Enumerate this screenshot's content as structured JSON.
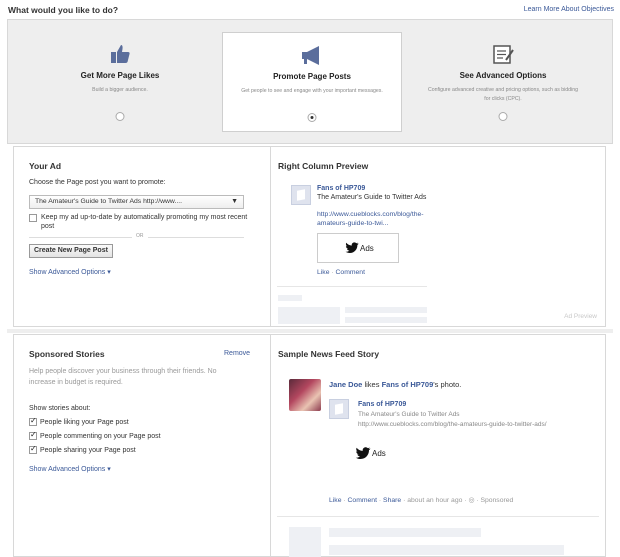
{
  "header": {
    "question": "What would you like to do?",
    "learn_more": "Learn More About Objectives"
  },
  "objectives": [
    {
      "icon": "thumbs-up-icon",
      "title": "Get More Page Likes",
      "description": "Build a bigger audience.",
      "selected": false
    },
    {
      "icon": "megaphone-icon",
      "title": "Promote Page Posts",
      "description": "Get people to see and engage with your important messages.",
      "selected": true
    },
    {
      "icon": "clipboard-icon",
      "title": "See Advanced Options",
      "description": "Configure advanced creative and pricing options, such as bidding for clicks (CPC).",
      "selected": false
    }
  ],
  "your_ad": {
    "heading": "Your Ad",
    "choose_label": "Choose the Page post you want to promote:",
    "selected_post": "The Amateur's Guide to Twitter Ads http://www....",
    "keep_updated": "Keep my ad up-to-date by automatically promoting my most recent post",
    "keep_updated_checked": false,
    "or": "OR",
    "create_button": "Create New Page Post",
    "advanced": "Show Advanced Options"
  },
  "right_column": {
    "heading": "Right Column Preview",
    "page_name": "Fans of HP709",
    "post_title": "The Amateur's Guide to Twitter Ads",
    "url": "http://www.cueblocks.com/blog/the-amateurs-guide-to-twi...",
    "image_text": "Ads",
    "like": "Like",
    "comment": "Comment",
    "ad_preview_label": "Ad Preview"
  },
  "sponsored_stories": {
    "heading": "Sponsored Stories",
    "remove": "Remove",
    "description": "Help people discover your business through their friends. No increase in budget is required.",
    "show_about": "Show stories about:",
    "options": [
      {
        "label": "People liking your Page post",
        "checked": true
      },
      {
        "label": "People commenting on your Page post",
        "checked": true
      },
      {
        "label": "People sharing your Page post",
        "checked": true
      }
    ],
    "advanced": "Show Advanced Options"
  },
  "news_feed": {
    "heading": "Sample News Feed Story",
    "user_name": "Jane Doe",
    "likes_text": "likes",
    "page_name": "Fans of HP709",
    "photo_text": "'s photo.",
    "post_page": "Fans of HP709",
    "post_desc": "The Amateur's Guide to Twitter Ads",
    "url": "http://www.cueblocks.com/blog/the-amateurs-guide-to-twitter-ads/",
    "image_text": "Ads",
    "like": "Like",
    "comment": "Comment",
    "share": "Share",
    "time": "about an hour ago",
    "sponsored": "Sponsored"
  },
  "colors": {
    "link": "#3b5998",
    "panel_bg": "#eeeeee",
    "border": "#d8d8d8"
  }
}
